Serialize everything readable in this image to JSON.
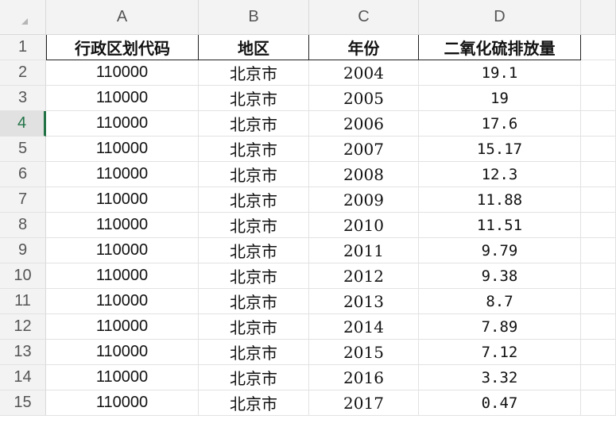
{
  "columns": [
    "A",
    "B",
    "C",
    "D"
  ],
  "rows": [
    "1",
    "2",
    "3",
    "4",
    "5",
    "6",
    "7",
    "8",
    "9",
    "10",
    "11",
    "12",
    "13",
    "14",
    "15"
  ],
  "active_row": "4",
  "header": [
    "行政区划代码",
    "地区",
    "年份",
    "二氧化硫排放量"
  ],
  "data": [
    [
      "110000",
      "北京市",
      "2004",
      "19.1"
    ],
    [
      "110000",
      "北京市",
      "2005",
      "19"
    ],
    [
      "110000",
      "北京市",
      "2006",
      "17.6"
    ],
    [
      "110000",
      "北京市",
      "2007",
      "15.17"
    ],
    [
      "110000",
      "北京市",
      "2008",
      "12.3"
    ],
    [
      "110000",
      "北京市",
      "2009",
      "11.88"
    ],
    [
      "110000",
      "北京市",
      "2010",
      "11.51"
    ],
    [
      "110000",
      "北京市",
      "2011",
      "9.79"
    ],
    [
      "110000",
      "北京市",
      "2012",
      "9.38"
    ],
    [
      "110000",
      "北京市",
      "2013",
      "8.7"
    ],
    [
      "110000",
      "北京市",
      "2014",
      "7.89"
    ],
    [
      "110000",
      "北京市",
      "2015",
      "7.12"
    ],
    [
      "110000",
      "北京市",
      "2016",
      "3.32"
    ],
    [
      "110000",
      "北京市",
      "2017",
      "0.47"
    ]
  ],
  "colors": {
    "header_bg": "#f3f3f3",
    "active_accent": "#217346",
    "gridline": "#e2e2e2"
  },
  "icons": {
    "corner": "select-all-triangle-icon"
  }
}
